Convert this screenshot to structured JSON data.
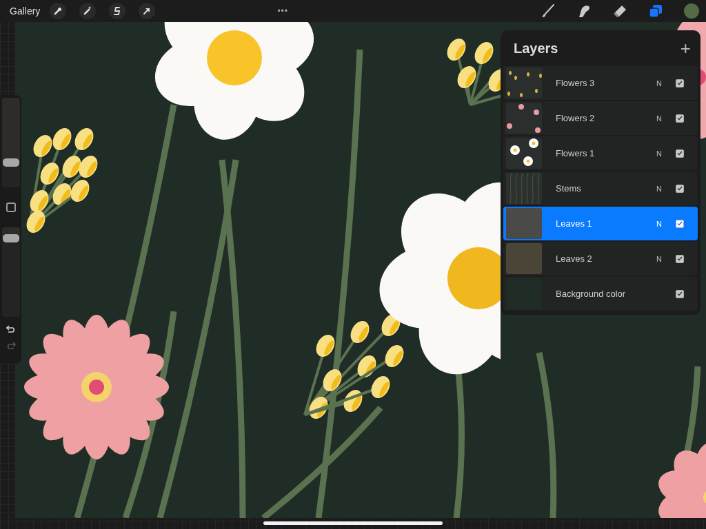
{
  "top_bar": {
    "gallery": "Gallery",
    "more": "•••",
    "color": "#556b45",
    "tools": [
      {
        "kind": "brush",
        "selected": false
      },
      {
        "kind": "smudge",
        "selected": false
      },
      {
        "kind": "eraser",
        "selected": false
      },
      {
        "kind": "layers",
        "selected": true
      }
    ]
  },
  "sidebar": {
    "size_slider": {
      "level": 0.28
    },
    "opacity_slider": {
      "level": 0.88
    },
    "undo": {
      "disabled": false
    },
    "redo": {
      "disabled": true
    }
  },
  "layers_panel": {
    "title": "Layers",
    "add": "+",
    "layers": [
      {
        "name": "Flowers 3",
        "blend": "N",
        "visible": true,
        "selected": false,
        "thumb": {
          "kind": "buds"
        }
      },
      {
        "name": "Flowers 2",
        "blend": "N",
        "visible": true,
        "selected": false,
        "thumb": {
          "kind": "pink"
        }
      },
      {
        "name": "Flowers 1",
        "blend": "N",
        "visible": true,
        "selected": false,
        "thumb": {
          "kind": "daisies"
        }
      },
      {
        "name": "Stems",
        "blend": "N",
        "visible": true,
        "selected": false,
        "thumb": {
          "kind": "stems"
        }
      },
      {
        "name": "Leaves 1",
        "blend": "N",
        "visible": true,
        "selected": true,
        "thumb": {
          "kind": "fill",
          "color": "#4a4a48"
        }
      },
      {
        "name": "Leaves 2",
        "blend": "N",
        "visible": true,
        "selected": false,
        "thumb": {
          "kind": "fill",
          "color": "#4a4536"
        }
      },
      {
        "name": "Background color",
        "visible": true,
        "selected": false,
        "thumb": {
          "kind": "fill",
          "color": "#1f2d26"
        }
      }
    ]
  }
}
